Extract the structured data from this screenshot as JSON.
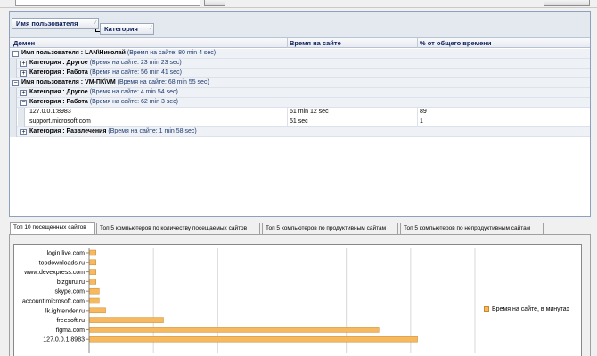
{
  "group_panel": {
    "chips": [
      "Имя пользователя",
      "Категория"
    ]
  },
  "grid": {
    "columns": [
      "Домен",
      "Время на сайте",
      "% от общего времени"
    ],
    "rows": [
      {
        "kind": "group",
        "level": 0,
        "expander": "−",
        "label": "Имя пользователя : LAN\\Николай",
        "info": "(Время на сайте: 80 min 4 sec)"
      },
      {
        "kind": "group",
        "level": 1,
        "expander": "+",
        "label": "Категория : Другое",
        "info": "(Время на сайте: 23 min 23 sec)"
      },
      {
        "kind": "group",
        "level": 1,
        "expander": "+",
        "label": "Категория : Работа",
        "info": "(Время на сайте: 56 min 41 sec)"
      },
      {
        "kind": "group",
        "level": 0,
        "expander": "−",
        "label": "Имя пользователя : VM-ПК\\VM",
        "info": "(Время на сайте: 68 min 55 sec)"
      },
      {
        "kind": "group",
        "level": 1,
        "expander": "+",
        "label": "Категория : Другое",
        "info": "(Время на сайте: 4 min 54 sec)"
      },
      {
        "kind": "group",
        "level": 1,
        "expander": "−",
        "label": "Категория : Работа",
        "info": "(Время на сайте: 62 min 3 sec)"
      },
      {
        "kind": "data",
        "level": 2,
        "domain": "127.0.0.1:8983",
        "time": "61 min 12 sec",
        "percent": "89"
      },
      {
        "kind": "data",
        "level": 2,
        "domain": "support.microsoft.com",
        "time": "51 sec",
        "percent": "1"
      },
      {
        "kind": "group",
        "level": 1,
        "expander": "+",
        "label": "Категория : Развлечения",
        "info": "(Время на сайте: 1 min 58 sec)"
      }
    ]
  },
  "tabs": [
    "Топ 10 посещенных сайтов",
    "Топ 5 компьютеров по количеству посещаемых сайтов",
    "Топ 5 компьютеров по продуктивным сайтам",
    "Топ 5 компьютеров по непродуктивным сайтам"
  ],
  "active_tab": 0,
  "chart_data": {
    "type": "bar",
    "orientation": "horizontal",
    "categories": [
      "login.live.com",
      "topdownloads.ru",
      "www.devexpress.com",
      "bizguru.ru",
      "skype.com",
      "account.microsoft.com",
      "lk.ightender.ru",
      "freesoft.ru",
      "figma.com",
      "127.0.0.1:8983"
    ],
    "series": [
      {
        "name": "Время на сайте, в минутах",
        "values": [
          1,
          1,
          1,
          1,
          1.5,
          1.5,
          2.5,
          11.5,
          45,
          51
        ]
      }
    ],
    "xlim": [
      0,
      60
    ],
    "grid": true,
    "legend": "right",
    "bar_color": "#f6b960"
  }
}
